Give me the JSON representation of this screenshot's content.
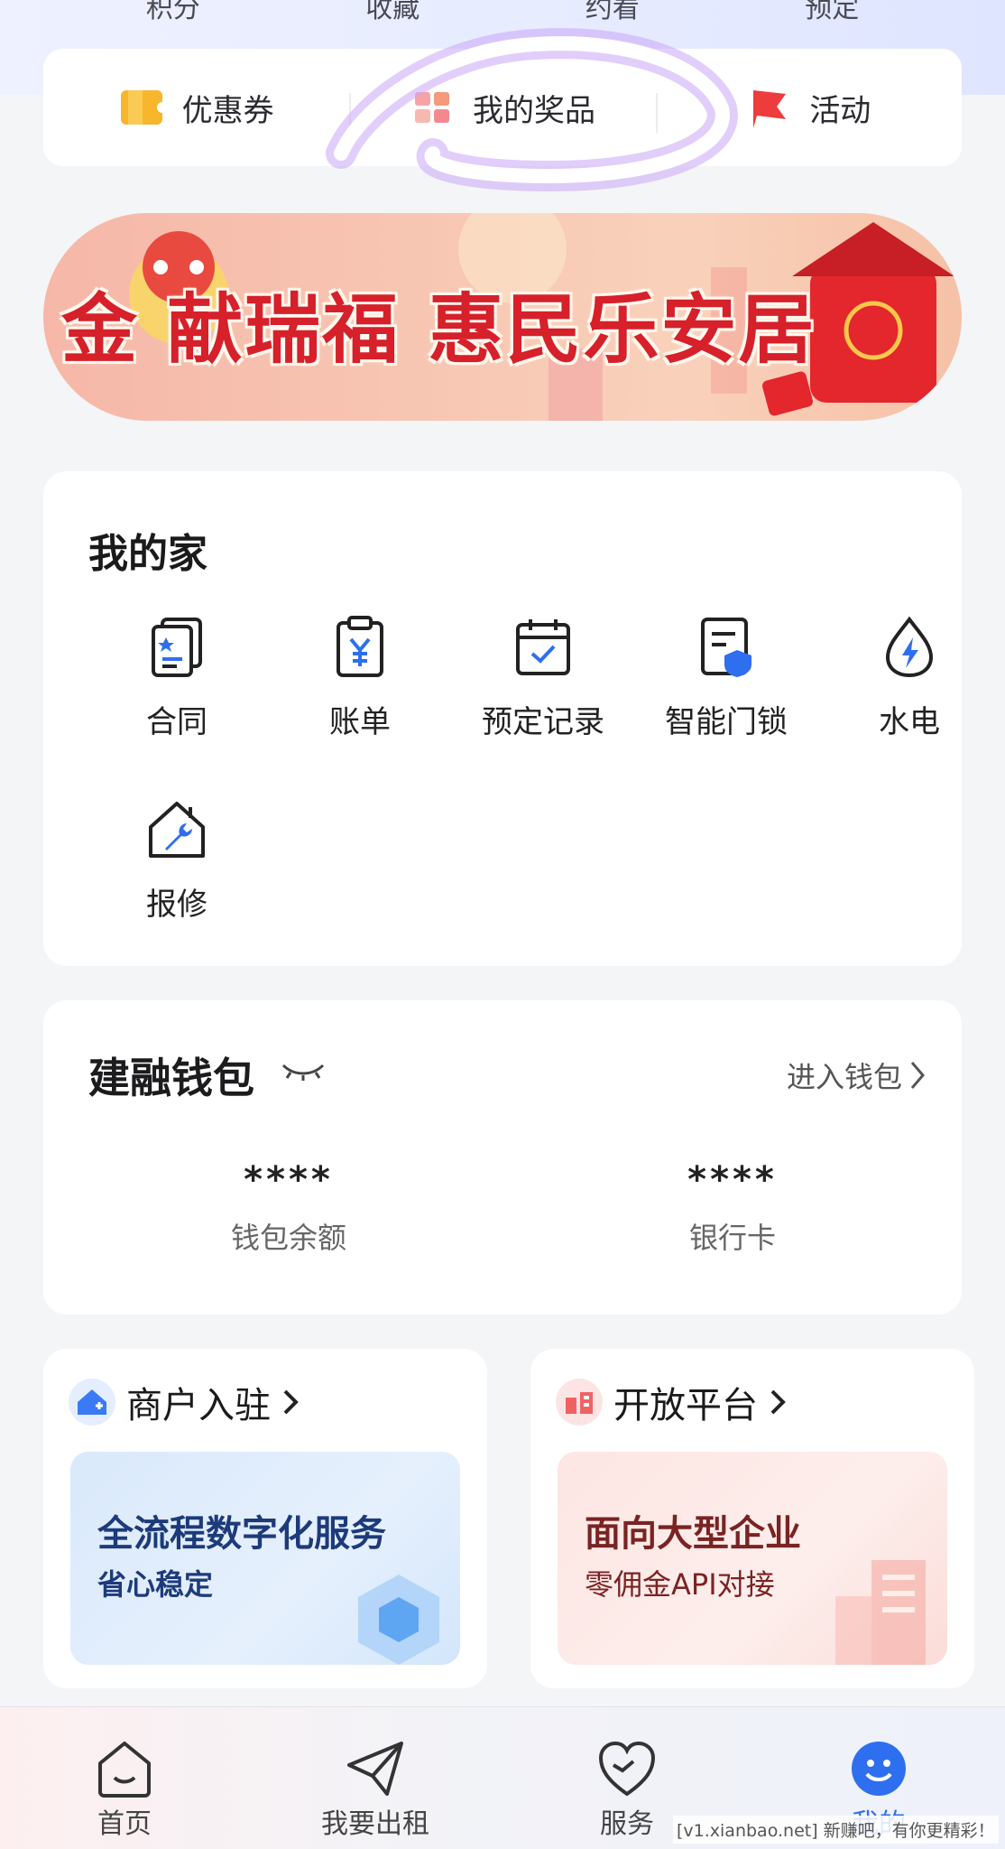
{
  "stats": [
    "积分",
    "收藏",
    "约看",
    "预定"
  ],
  "quick_bar": [
    {
      "label": "优惠券",
      "icon": "coupon-icon"
    },
    {
      "label": "我的奖品",
      "icon": "prize-icon"
    },
    {
      "label": "活动",
      "icon": "flag-icon"
    }
  ],
  "banner": {
    "title": "金 献瑞福 惠民乐安居"
  },
  "home": {
    "title": "我的家",
    "items": [
      {
        "label": "合同",
        "icon": "contract-icon"
      },
      {
        "label": "账单",
        "icon": "bill-icon"
      },
      {
        "label": "预定记录",
        "icon": "calendar-icon"
      },
      {
        "label": "智能门锁",
        "icon": "smart-lock-icon"
      },
      {
        "label": "水电",
        "icon": "utility-icon"
      },
      {
        "label": "报修",
        "icon": "repair-icon"
      }
    ]
  },
  "wallet": {
    "title": "建融钱包",
    "enter_label": "进入钱包",
    "balance_value": "****",
    "balance_label": "钱包余额",
    "card_value": "****",
    "card_label": "银行卡"
  },
  "promos": [
    {
      "title": "商户入驻",
      "main": "全流程数字化服务",
      "sub": "省心稳定"
    },
    {
      "title": "开放平台",
      "main": "面向大型企业",
      "sub": "零佣金API对接"
    }
  ],
  "tabs": [
    {
      "label": "首页",
      "icon": "home-icon"
    },
    {
      "label": "我要出租",
      "icon": "send-icon"
    },
    {
      "label": "服务",
      "icon": "heart-icon"
    },
    {
      "label": "我的",
      "icon": "profile-icon"
    }
  ],
  "watermark": "[v1.xianbao.net] 新赚吧，有你更精彩！",
  "colors": {
    "accent": "#2e6ff0",
    "annotation": "#b98cf5",
    "banner_red": "#d6202a"
  }
}
